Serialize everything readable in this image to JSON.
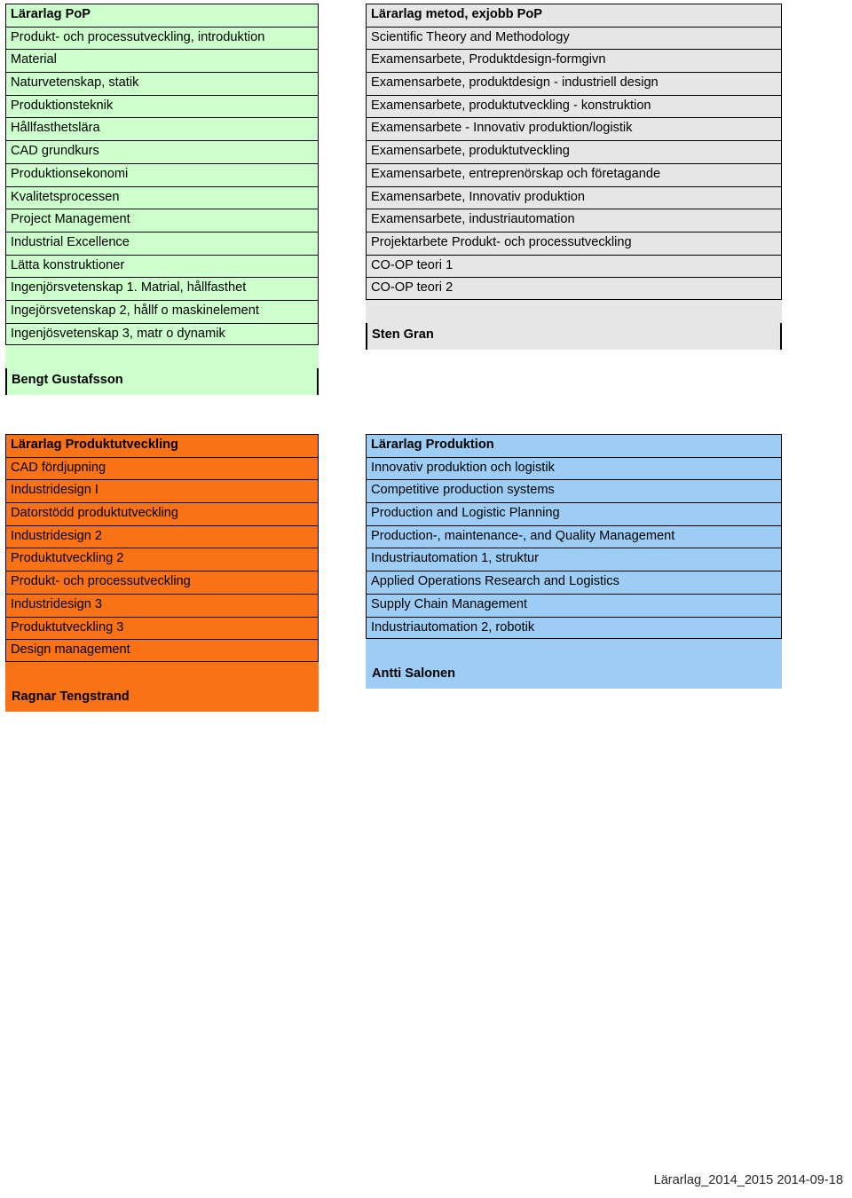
{
  "document": {
    "footer": "Lärarlag_2014_2015 2014-09-18"
  },
  "teams": [
    {
      "id": "pop",
      "header": "Lärarlag PoP",
      "color": "#ccffcc",
      "teacher": "Bengt Gustafsson",
      "courses": [
        "Produkt- och processutveckling, introduktion",
        "Material",
        "Naturvetenskap, statik",
        "Produktionsteknik",
        "Hållfasthetslära",
        "CAD grundkurs",
        "Produktionsekonomi",
        "Kvalitetsprocessen",
        "Project Management",
        "Industrial Excellence",
        "Lätta konstruktioner",
        "Ingenjörsvetenskap 1. Matrial, hållfasthet",
        "Ingejörsvetenskap 2, hållf o maskinelement",
        "Ingenjösvetenskap 3, matr o dynamik"
      ]
    },
    {
      "id": "metod",
      "header": "Lärarlag metod, exjobb PoP",
      "color": "#e6e6e6",
      "teacher": "Sten Gran",
      "courses": [
        "Scientific Theory and Methodology",
        "Examensarbete, Produktdesign-formgivn",
        "Examensarbete, produktdesign - industriell design",
        "Examensarbete, produktutveckling - konstruktion",
        "Examensarbete - Innovativ produktion/logistik",
        "Examensarbete, produktutveckling",
        "Examensarbete, entreprenörskap och företagande",
        "Examensarbete, Innovativ produktion",
        "Examensarbete, industriautomation",
        "Projektarbete Produkt- och processutveckling",
        "CO-OP teori 1",
        "CO-OP teori 2"
      ]
    },
    {
      "id": "produktutveckling",
      "header": "Lärarlag Produktutveckling",
      "color": "#f97316",
      "teacher": "Ragnar Tengstrand",
      "courses": [
        "CAD fördjupning",
        "Industridesign I",
        "Datorstödd produktutveckling",
        "Industridesign 2",
        "Produktutveckling 2",
        "Produkt- och processutveckling",
        "Industridesign 3",
        "Produktutveckling 3",
        "Design management"
      ]
    },
    {
      "id": "produktion",
      "header": "Lärarlag Produktion",
      "color": "#9dcdf5",
      "teacher": "Antti Salonen",
      "courses": [
        "Innovativ produktion och logistik",
        "Competitive production systems",
        "Production and Logistic Planning",
        "Production-, maintenance-, and Quality Management",
        "Industriautomation 1, struktur",
        "Applied Operations Research and Logistics",
        "Supply Chain Management",
        "Industriautomation 2, robotik"
      ]
    }
  ]
}
